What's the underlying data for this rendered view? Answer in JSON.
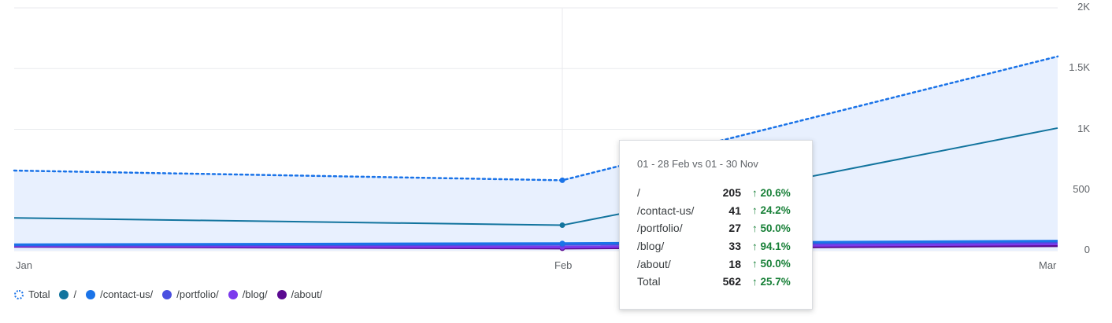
{
  "chart_data": {
    "type": "line",
    "categories": [
      "Jan",
      "Feb",
      "Mar"
    ],
    "ylim": [
      0,
      2000
    ],
    "y_ticks": [
      "0",
      "500",
      "1K",
      "1.5K",
      "2K"
    ],
    "grid": true,
    "legend_position": "bottom-left",
    "series": [
      {
        "name": "Total",
        "values": [
          660,
          580,
          1600
        ],
        "style": "dotted",
        "color": "#1a73e8",
        "filled": true,
        "fill": "#e8f0fe"
      },
      {
        "name": "/",
        "values": [
          270,
          210,
          1010
        ],
        "style": "solid",
        "color": "#12749e"
      },
      {
        "name": "/contact-us/",
        "values": [
          50,
          60,
          80
        ],
        "style": "solid",
        "color": "#1a73e8"
      },
      {
        "name": "/portfolio/",
        "values": [
          45,
          50,
          70
        ],
        "style": "solid",
        "color": "#4a4fe0"
      },
      {
        "name": "/blog/",
        "values": [
          40,
          30,
          55
        ],
        "style": "solid",
        "color": "#7c3aed"
      },
      {
        "name": "/about/",
        "values": [
          35,
          20,
          40
        ],
        "style": "solid",
        "color": "#5b0a91"
      }
    ]
  },
  "tooltip": {
    "title": "01 - 28 Feb vs 01 - 30 Nov",
    "rows": [
      {
        "label": "/",
        "value": "205",
        "change": "↑ 20.6%"
      },
      {
        "label": "/contact-us/",
        "value": "41",
        "change": "↑ 24.2%"
      },
      {
        "label": "/portfolio/",
        "value": "27",
        "change": "↑ 50.0%"
      },
      {
        "label": "/blog/",
        "value": "33",
        "change": "↑ 94.1%"
      },
      {
        "label": "/about/",
        "value": "18",
        "change": "↑ 50.0%"
      },
      {
        "label": "Total",
        "value": "562",
        "change": "↑ 25.7%"
      }
    ]
  },
  "legend": [
    {
      "label": "Total",
      "color": "#1a73e8",
      "dashed": true
    },
    {
      "label": "/",
      "color": "#12749e"
    },
    {
      "label": "/contact-us/",
      "color": "#1a73e8"
    },
    {
      "label": "/portfolio/",
      "color": "#4a4fe0"
    },
    {
      "label": "/blog/",
      "color": "#7c3aed"
    },
    {
      "label": "/about/",
      "color": "#5b0a91"
    }
  ]
}
